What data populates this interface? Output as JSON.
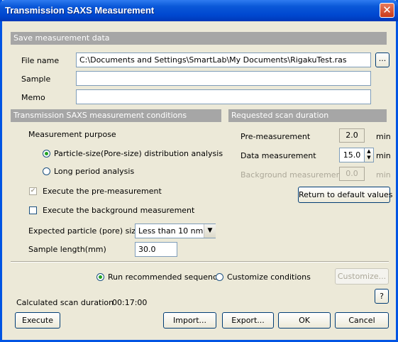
{
  "window": {
    "title": "Transmission SAXS Measurement",
    "close_symbol": "✕"
  },
  "save": {
    "header": "Save measurement data",
    "file_name_label": "File name",
    "file_name_value": "C:\\Documents and Settings\\SmartLab\\My Documents\\RigakuTest.ras",
    "browse_label": "...",
    "sample_label": "Sample",
    "sample_value": "",
    "memo_label": "Memo",
    "memo_value": ""
  },
  "conditions": {
    "header": "Transmission SAXS measurement conditions",
    "purpose_label": "Measurement purpose",
    "purpose_options": [
      {
        "label": "Particle-size(Pore-size) distribution analysis",
        "selected": true
      },
      {
        "label": "Long period analysis",
        "selected": false
      }
    ],
    "pre_measurement_check": {
      "label": "Execute the pre-measurement",
      "checked": true,
      "enabled": false
    },
    "background_check": {
      "label": "Execute the background measurement",
      "checked": false,
      "enabled": true
    },
    "particle_size_label": "Expected particle (pore) size",
    "particle_size_value": "Less than 10 nm",
    "sample_length_label": "Sample length(mm)",
    "sample_length_value": "30.0"
  },
  "duration": {
    "header": "Requested scan duration",
    "pre_label": "Pre-measurement",
    "pre_value": "2.0",
    "data_label": "Data measurement",
    "data_value": "15.0",
    "bg_label": "Background measurement",
    "bg_value": "0.0",
    "unit": "min",
    "reset_label": "Return to default values"
  },
  "sequence": {
    "recommended_label": "Run recommended sequence",
    "recommended_selected": true,
    "customize_label": "Customize conditions",
    "customize_button": "Customize..."
  },
  "footer": {
    "calc_label": "Calculated scan duration",
    "calc_value": "00:17:00",
    "help_label": "?",
    "execute": "Execute",
    "import": "Import...",
    "export": "Export...",
    "ok": "OK",
    "cancel": "Cancel"
  },
  "colors": {
    "title_bar": "#0054e3",
    "section_header": "#a6a6a6",
    "dialog_bg": "#ece9d8"
  }
}
